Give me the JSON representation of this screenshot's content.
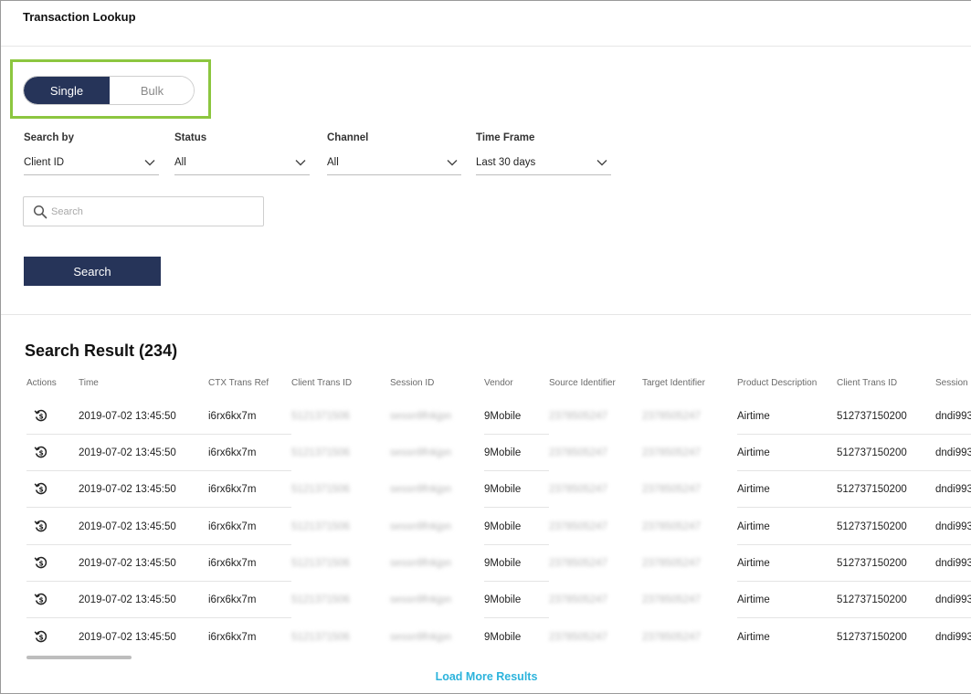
{
  "page": {
    "title": "Transaction Lookup"
  },
  "mode_toggle": {
    "single_label": "Single",
    "bulk_label": "Bulk",
    "active": "Single"
  },
  "filters": {
    "search_by": {
      "label": "Search by",
      "value": "Client ID"
    },
    "status": {
      "label": "Status",
      "value": "All"
    },
    "channel": {
      "label": "Channel",
      "value": "All"
    },
    "time_frame": {
      "label": "Time Frame",
      "value": "Last 30 days"
    }
  },
  "search": {
    "placeholder": "Search",
    "value": "",
    "button_label": "Search"
  },
  "results": {
    "title": "Search Result (234)",
    "columns": [
      "Actions",
      "Time",
      "CTX Trans Ref",
      "Client Trans ID",
      "Session ID",
      "Vendor",
      "Source Identifier",
      "Target Identifier",
      "Product Description",
      "Client Trans ID",
      "Session I"
    ],
    "rows": [
      {
        "time": "2019-07-02  13:45:50",
        "ctx_ref": "i6rx6kx7m",
        "client_trans_id": "5121371506",
        "session_id": "sessn9fnkjpn",
        "vendor": "9Mobile",
        "source": "2378505247",
        "target": "2378505247",
        "product": "Airtime",
        "client_trans_id2": "512737150200",
        "session_id2": "dndi993"
      },
      {
        "time": "2019-07-02  13:45:50",
        "ctx_ref": "i6rx6kx7m",
        "client_trans_id": "5121371506",
        "session_id": "sessn9fnkjpn",
        "vendor": "9Mobile",
        "source": "2378505247",
        "target": "2378505247",
        "product": "Airtime",
        "client_trans_id2": "512737150200",
        "session_id2": "dndi993"
      },
      {
        "time": "2019-07-02  13:45:50",
        "ctx_ref": "i6rx6kx7m",
        "client_trans_id": "5121371506",
        "session_id": "sessn9fnkjpn",
        "vendor": "9Mobile",
        "source": "2378505247",
        "target": "2378505247",
        "product": "Airtime",
        "client_trans_id2": "512737150200",
        "session_id2": "dndi993"
      },
      {
        "time": "2019-07-02  13:45:50",
        "ctx_ref": "i6rx6kx7m",
        "client_trans_id": "5121371506",
        "session_id": "sessn9fnkjpn",
        "vendor": "9Mobile",
        "source": "2378505247",
        "target": "2378505247",
        "product": "Airtime",
        "client_trans_id2": "512737150200",
        "session_id2": "dndi993"
      },
      {
        "time": "2019-07-02  13:45:50",
        "ctx_ref": "i6rx6kx7m",
        "client_trans_id": "5121371506",
        "session_id": "sessn9fnkjpn",
        "vendor": "9Mobile",
        "source": "2378505247",
        "target": "2378505247",
        "product": "Airtime",
        "client_trans_id2": "512737150200",
        "session_id2": "dndi993"
      },
      {
        "time": "2019-07-02  13:45:50",
        "ctx_ref": "i6rx6kx7m",
        "client_trans_id": "5121371506",
        "session_id": "sessn9fnkjpn",
        "vendor": "9Mobile",
        "source": "2378505247",
        "target": "2378505247",
        "product": "Airtime",
        "client_trans_id2": "512737150200",
        "session_id2": "dndi993"
      },
      {
        "time": "2019-07-02  13:45:50",
        "ctx_ref": "i6rx6kx7m",
        "client_trans_id": "5121371506",
        "session_id": "sessn9fnkjpn",
        "vendor": "9Mobile",
        "source": "2378505247",
        "target": "2378505247",
        "product": "Airtime",
        "client_trans_id2": "512737150200",
        "session_id2": "dndi993"
      }
    ],
    "action_icon": "transaction-history-icon",
    "load_more_label": "Load More Results"
  },
  "colors": {
    "primary": "#263459",
    "highlight": "#8cc63f",
    "link": "#2cb3dc"
  }
}
